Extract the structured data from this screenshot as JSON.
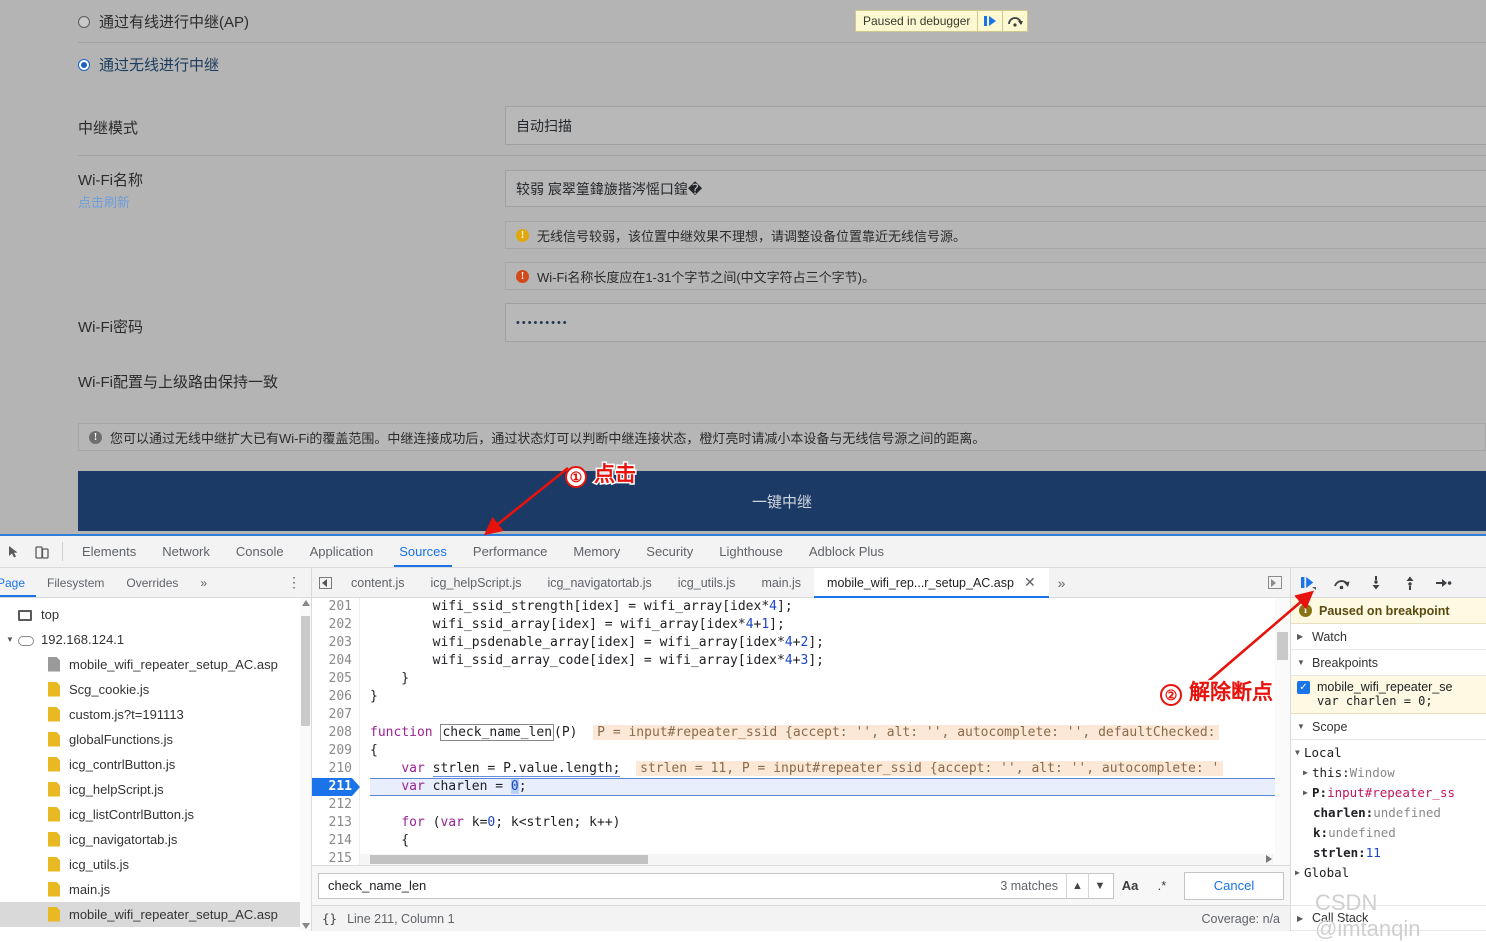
{
  "router_page": {
    "radio_wired": {
      "label": "通过有线进行中继(AP)",
      "checked": false
    },
    "radio_wireless": {
      "label": "通过无线进行中继",
      "checked": true
    },
    "fields": {
      "relay_mode_label": "中继模式",
      "relay_mode_value": "自动扫描",
      "wifi_name_label": "Wi-Fi名称",
      "wifi_name_refresh": "点击刷新",
      "wifi_name_value": "较弱  宸翠篁鍏旇揩涔愮口鍠�",
      "wifi_pwd_label": "Wi-Fi密码",
      "wifi_pwd_value": "•••••••••",
      "wifi_sync_label": "Wi-Fi配置与上级路由保持一致"
    },
    "messages": {
      "warn_signal": "无线信号较弱，该位置中继效果不理想，请调整设备位置靠近无线信号源。",
      "err_name_len": "Wi-Fi名称长度应在1-31个字节之间(中文字符占三个字节)。",
      "info_tip": "您可以通过无线中继扩大已有Wi-Fi的覆盖范围。中继连接成功后，通过状态灯可以判断中继连接状态，橙灯亮时请减小本设备与无线信号源之间的距离。"
    },
    "relay_button": "一键中继",
    "paused_toast": {
      "text": "Paused in debugger",
      "resume_icon": "resume-icon",
      "step-over_icon": "step-over-icon"
    }
  },
  "devtools": {
    "main_tabs": [
      {
        "label": "Elements",
        "active": false
      },
      {
        "label": "Network",
        "active": false
      },
      {
        "label": "Console",
        "active": false
      },
      {
        "label": "Application",
        "active": false
      },
      {
        "label": "Sources",
        "active": true
      },
      {
        "label": "Performance",
        "active": false
      },
      {
        "label": "Memory",
        "active": false
      },
      {
        "label": "Security",
        "active": false
      },
      {
        "label": "Lighthouse",
        "active": false
      },
      {
        "label": "Adblock Plus",
        "active": false
      }
    ],
    "nav_tabs": [
      {
        "label": "Page",
        "active": true
      },
      {
        "label": "Filesystem",
        "active": false
      },
      {
        "label": "Overrides",
        "active": false
      },
      {
        "label": "»",
        "active": false
      }
    ],
    "nav_more": "⋮",
    "tree": [
      {
        "label": "top",
        "icon": "frame-icon",
        "indent": 0,
        "twist": "",
        "selected": false
      },
      {
        "label": "192.168.124.1",
        "icon": "cloud-icon",
        "indent": 1,
        "twist": "▼",
        "selected": false
      },
      {
        "label": "mobile_wifi_repeater_setup_AC.asp",
        "icon": "file-grey-icon",
        "indent": 2,
        "twist": "",
        "selected": false
      },
      {
        "label": "Scg_cookie.js",
        "icon": "file-js-icon",
        "indent": 2,
        "twist": "",
        "selected": false
      },
      {
        "label": "custom.js?t=191113",
        "icon": "file-js-icon",
        "indent": 2,
        "twist": "",
        "selected": false
      },
      {
        "label": "globalFunctions.js",
        "icon": "file-js-icon",
        "indent": 2,
        "twist": "",
        "selected": false
      },
      {
        "label": "icg_contrlButton.js",
        "icon": "file-js-icon",
        "indent": 2,
        "twist": "",
        "selected": false
      },
      {
        "label": "icg_helpScript.js",
        "icon": "file-js-icon",
        "indent": 2,
        "twist": "",
        "selected": false
      },
      {
        "label": "icg_listContrlButton.js",
        "icon": "file-js-icon",
        "indent": 2,
        "twist": "",
        "selected": false
      },
      {
        "label": "icg_navigatortab.js",
        "icon": "file-js-icon",
        "indent": 2,
        "twist": "",
        "selected": false
      },
      {
        "label": "icg_utils.js",
        "icon": "file-js-icon",
        "indent": 2,
        "twist": "",
        "selected": false
      },
      {
        "label": "main.js",
        "icon": "file-js-icon",
        "indent": 2,
        "twist": "",
        "selected": false
      },
      {
        "label": "mobile_wifi_repeater_setup_AC.asp",
        "icon": "file-js-icon",
        "indent": 2,
        "twist": "",
        "selected": true
      }
    ],
    "file_tabs": [
      {
        "label": "content.js",
        "active": false,
        "closable": false
      },
      {
        "label": "icg_helpScript.js",
        "active": false,
        "closable": false
      },
      {
        "label": "icg_navigatortab.js",
        "active": false,
        "closable": false
      },
      {
        "label": "icg_utils.js",
        "active": false,
        "closable": false
      },
      {
        "label": "main.js",
        "active": false,
        "closable": false
      },
      {
        "label": "mobile_wifi_rep...r_setup_AC.asp",
        "active": true,
        "closable": true
      }
    ],
    "file_tabs_more": "»",
    "code": {
      "first_line": 201,
      "current_line": 211,
      "lines": [
        {
          "n": 201,
          "text": "        wifi_ssid_strength[idex] = wifi_array[idex*4];"
        },
        {
          "n": 202,
          "text": "        wifi_ssid_array[idex] = wifi_array[idex*4+1];"
        },
        {
          "n": 203,
          "text": "        wifi_psdenable_array[idex] = wifi_array[idex*4+2];"
        },
        {
          "n": 204,
          "text": "        wifi_ssid_array_code[idex] = wifi_array[idex*4+3];"
        },
        {
          "n": 205,
          "text": "    }"
        },
        {
          "n": 206,
          "text": "}"
        },
        {
          "n": 207,
          "text": ""
        },
        {
          "n": 208,
          "text": "function check_name_len(P)"
        },
        {
          "n": 209,
          "text": "{"
        },
        {
          "n": 210,
          "text": "    var strlen = P.value.length;"
        },
        {
          "n": 211,
          "text": "    var charlen = 0;"
        },
        {
          "n": 212,
          "text": ""
        },
        {
          "n": 213,
          "text": "    for (var k=0; k<strlen; k++)"
        },
        {
          "n": 214,
          "text": "    {"
        },
        {
          "n": 215,
          "text": ""
        }
      ],
      "inline_208": "P = input#repeater_ssid {accept: '', alt: '', autocomplete: '', defaultChecked:",
      "inline_210": "strlen = 11, P = input#repeater_ssid {accept: '', alt: '', autocomplete: '"
    },
    "search": {
      "value": "check_name_len",
      "matches": "3 matches",
      "up_icon": "chevron-up-icon",
      "down_icon": "chevron-down-icon",
      "match_case": "Aa",
      "regex": ".*",
      "cancel": "Cancel"
    },
    "status": {
      "format_icon": "{}",
      "position": "Line 211, Column 1",
      "coverage": "Coverage: n/a"
    },
    "debugger": {
      "buttons": [
        {
          "name": "resume-icon",
          "label": "▶|"
        },
        {
          "name": "step-over-icon",
          "label": "↷"
        },
        {
          "name": "step-into-icon",
          "label": "↓"
        },
        {
          "name": "step-out-icon",
          "label": "↑"
        },
        {
          "name": "step-icon",
          "label": "→•"
        }
      ],
      "paused_banner": "Paused on breakpoint",
      "watch_label": "Watch",
      "breakpoints_label": "Breakpoints",
      "breakpoint": {
        "file": "mobile_wifi_repeater_se",
        "code": "var charlen = 0;",
        "checked": true
      },
      "scope_label": "Scope",
      "scope": [
        {
          "indent": 0,
          "twist": "▼",
          "name": "Local",
          "value": "",
          "vtype": ""
        },
        {
          "indent": 1,
          "twist": "▶",
          "name": "this: ",
          "value": "Window",
          "vtype": "grey"
        },
        {
          "indent": 1,
          "twist": "▶",
          "name": "P: ",
          "value": "input#repeater_ss",
          "vtype": "pink",
          "bold": true
        },
        {
          "indent": 2,
          "twist": "",
          "name": "charlen: ",
          "value": "undefined",
          "vtype": "grey",
          "bold": true
        },
        {
          "indent": 2,
          "twist": "",
          "name": "k: ",
          "value": "undefined",
          "vtype": "grey",
          "bold": true
        },
        {
          "indent": 2,
          "twist": "",
          "name": "strlen: ",
          "value": "11",
          "vtype": "num",
          "bold": true
        },
        {
          "indent": 0,
          "twist": "▶",
          "name": "Global",
          "value": "",
          "vtype": ""
        }
      ],
      "callstack_label": "Call Stack"
    }
  },
  "annotations": {
    "step1": {
      "num": "①",
      "text": "点击"
    },
    "step2": {
      "num": "②",
      "text": "解除断点"
    }
  },
  "watermark": "CSDN @imtanqin"
}
